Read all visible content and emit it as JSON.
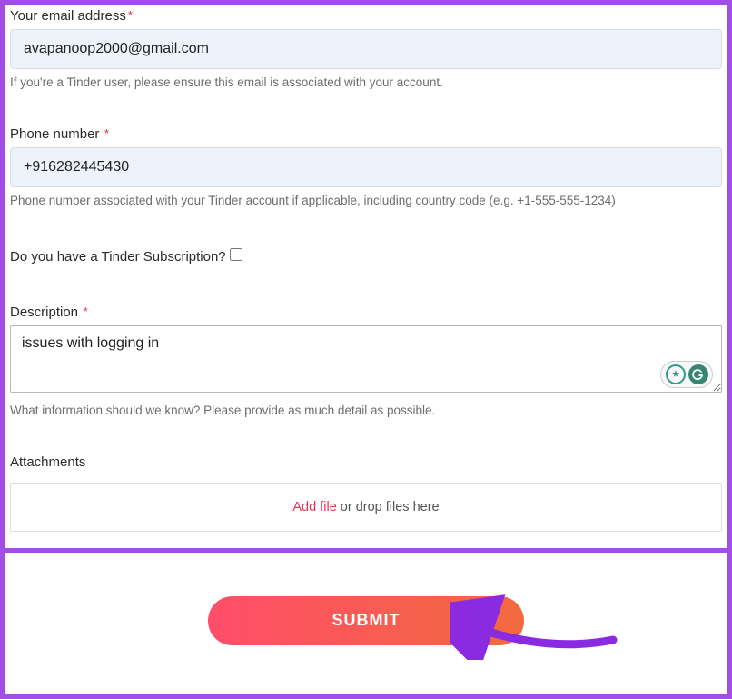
{
  "email": {
    "label": "Your email address",
    "value": "avapanoop2000@gmail.com",
    "help": "If you're a Tinder user, please ensure this email is associated with your account."
  },
  "phone": {
    "label": "Phone number",
    "value": "+916282445430",
    "help": "Phone number associated with your Tinder account if applicable, including country code (e.g. +1-555-555-1234)"
  },
  "subscription": {
    "label": "Do you have a Tinder Subscription?"
  },
  "description": {
    "label": "Description",
    "value": "issues with logging in",
    "help": "What information should we know? Please provide as much detail as possible."
  },
  "attachments": {
    "label": "Attachments",
    "add": "Add file",
    "drop": " or drop files here"
  },
  "submit": {
    "label": "SUBMIT"
  },
  "widget": {
    "g": "G"
  }
}
